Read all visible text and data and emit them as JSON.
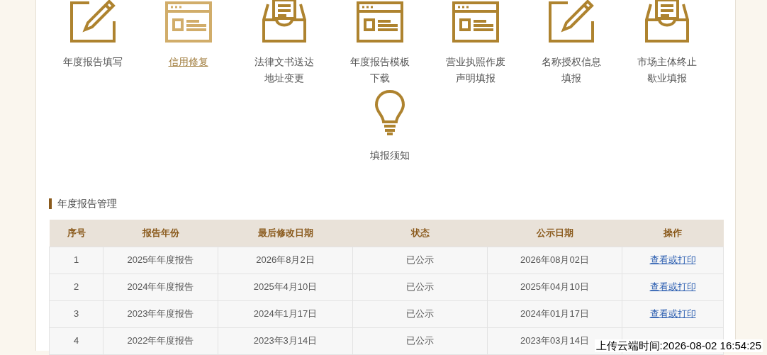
{
  "services": [
    {
      "kind": "pencil",
      "lines": [
        "年度报告填写"
      ],
      "selected": false
    },
    {
      "kind": "window",
      "lines": [
        "信用修复"
      ],
      "selected": true
    },
    {
      "kind": "inbox",
      "lines": [
        "法律文书送达",
        "地址变更"
      ],
      "selected": false
    },
    {
      "kind": "window",
      "lines": [
        "年度报告模板",
        "下载"
      ],
      "selected": false
    },
    {
      "kind": "window",
      "lines": [
        "营业执照作废",
        "声明填报"
      ],
      "selected": false
    },
    {
      "kind": "pencil",
      "lines": [
        "名称授权信息",
        "填报"
      ],
      "selected": false
    },
    {
      "kind": "inbox",
      "lines": [
        "市场主体终止",
        "歇业填报"
      ],
      "selected": false
    },
    {
      "kind": "bulb",
      "lines": [
        "填报须知"
      ],
      "selected": false
    }
  ],
  "section_title": "年度报告管理",
  "table": {
    "columns": [
      "序号",
      "报告年份",
      "最后修改日期",
      "状态",
      "公示日期",
      "操作"
    ],
    "rows": [
      [
        "1",
        "2025年年度报告",
        "2026年8月2日",
        "已公示",
        "2026年08月02日",
        "查看或打印"
      ],
      [
        "2",
        "2024年年度报告",
        "2025年4月10日",
        "已公示",
        "2025年04月10日",
        "查看或打印"
      ],
      [
        "3",
        "2023年年度报告",
        "2024年1月17日",
        "已公示",
        "2024年01月17日",
        "查看或打印"
      ],
      [
        "4",
        "2022年年度报告",
        "2023年3月14日",
        "已公示",
        "2023年03月14日"
      ]
    ]
  },
  "upload_time": "上传云端时间:2026-08-02 16:54:25"
}
